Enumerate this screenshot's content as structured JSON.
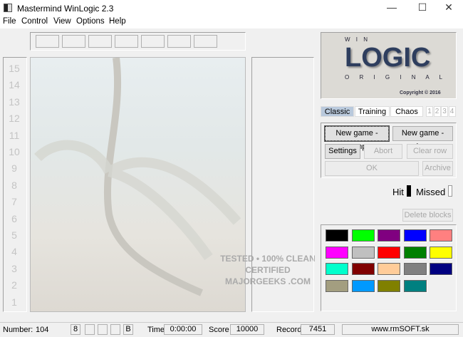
{
  "window": {
    "title": "Mastermind WinLogic 2.3",
    "minimize": "—",
    "maximize": "☐",
    "close": "✕"
  },
  "menu": [
    "File",
    "Control",
    "View",
    "Options",
    "Help"
  ],
  "row_numbers": [
    "15",
    "14",
    "13",
    "12",
    "11",
    "10",
    "9",
    "8",
    "7",
    "6",
    "5",
    "4",
    "3",
    "2",
    "1"
  ],
  "logo": {
    "top": "W I N",
    "main": "LOGIC",
    "bottom": "O R I G I N A L",
    "copyright": "Copyright © 2016"
  },
  "tabs": [
    "Classic",
    "Training",
    "Chaos"
  ],
  "levels": [
    "1",
    "2",
    "3",
    "4"
  ],
  "buttons": {
    "new_comp": "New game - comp",
    "new_player": "New game - player",
    "settings": "Settings",
    "abort": "Abort",
    "clear_row": "Clear row",
    "ok": "OK",
    "archive": "Archive",
    "delete_blocks": "Delete blocks"
  },
  "hit_label": "Hit",
  "missed_label": "Missed",
  "palette": [
    "#000000",
    "#00ff00",
    "#800080",
    "#0000ff",
    "#ff8080",
    "#ff00ff",
    "#c0c0c0",
    "#ff0000",
    "#008000",
    "#ffff00",
    "#00ffcc",
    "#800000",
    "#ffcc99",
    "#808080",
    "#000080",
    "#a39e80",
    "#0099ff",
    "#808000",
    "#008080"
  ],
  "status": {
    "number_label": "Number:",
    "number": "104",
    "colors": "8",
    "b": "B",
    "time_label": "Time",
    "time": "0:00:00",
    "score_label": "Score",
    "score": "10000",
    "record_label": "Record",
    "record": "7451",
    "website": "www.rmSOFT.sk"
  },
  "watermark": "TESTED • 100% CLEAN CERTIFIED MAJORGEEKS .COM"
}
